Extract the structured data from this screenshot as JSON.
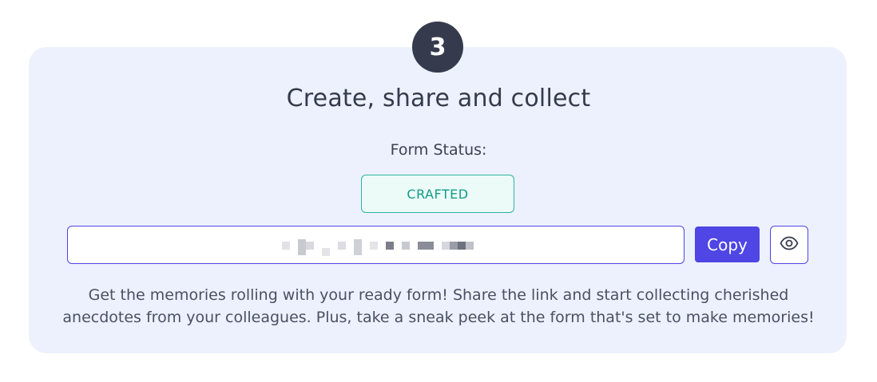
{
  "step": {
    "number": "3"
  },
  "section": {
    "title": "Create, share and collect",
    "status_label": "Form Status:",
    "status_value": "CRAFTED",
    "description_line1": "Get the memories rolling with your ready form! Share the link and start collecting cherished",
    "description_line2": "anecdotes from your colleagues. Plus, take a sneak peek at the form that's set to make memories!"
  },
  "share_link": {
    "value": "",
    "obscured": true
  },
  "actions": {
    "copy_label": "Copy",
    "preview_icon": "eye-icon"
  },
  "colors": {
    "card_bg": "#edf1fd",
    "badge_bg": "#353b4c",
    "accent": "#4f46e5",
    "status_text": "#129b89",
    "status_border": "#2fb3a3",
    "status_bg": "#ecfbf8"
  }
}
